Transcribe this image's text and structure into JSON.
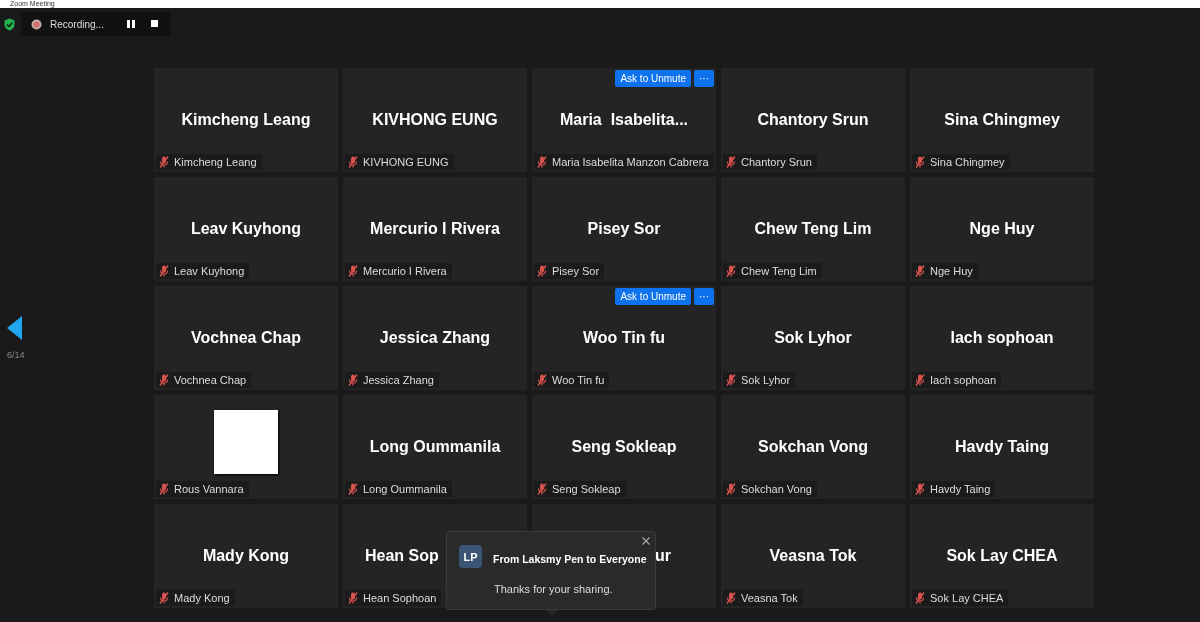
{
  "window": {
    "title": "Zoom Meeting"
  },
  "recording": {
    "label": "Recording..."
  },
  "pager": {
    "label": "6/14"
  },
  "tiles": [
    {
      "kind": "name",
      "display_name": "Kimcheng Leang",
      "label": "Kimcheng Leang",
      "muted": true
    },
    {
      "kind": "name",
      "display_name": "KIVHONG EUNG",
      "label": "KIVHONG EUNG",
      "muted": true
    },
    {
      "kind": "name",
      "display_name": "Maria  Isabelita...",
      "label": "Maria Isabelita Manzon Cabrera",
      "muted": true,
      "actions": {
        "button": "Ask to Unmute",
        "more": "···"
      }
    },
    {
      "kind": "name",
      "display_name": "Chantory Srun",
      "label": "Chantory Srun",
      "muted": true
    },
    {
      "kind": "name",
      "display_name": "Sina Chingmey",
      "label": "Sina Chingmey",
      "muted": true
    },
    {
      "kind": "name",
      "display_name": "Leav Kuyhong",
      "label": "Leav Kuyhong",
      "muted": true
    },
    {
      "kind": "name",
      "display_name": "Mercurio I Rivera",
      "label": "Mercurio I Rivera",
      "muted": true
    },
    {
      "kind": "name",
      "display_name": "Pisey Sor",
      "label": "Pisey Sor",
      "muted": true
    },
    {
      "kind": "name",
      "display_name": "Chew Teng Lim",
      "label": "Chew Teng Lim",
      "muted": true
    },
    {
      "kind": "name",
      "display_name": "Nge Huy",
      "label": "Nge Huy",
      "muted": true
    },
    {
      "kind": "name",
      "display_name": "Vochnea Chap",
      "label": "Vochnea Chap",
      "muted": true
    },
    {
      "kind": "name",
      "display_name": "Jessica Zhang",
      "label": "Jessica Zhang",
      "muted": true
    },
    {
      "kind": "name",
      "display_name": "Woo Tin fu",
      "label": "Woo Tin fu",
      "muted": true,
      "actions": {
        "button": "Ask to Unmute",
        "more": "···"
      }
    },
    {
      "kind": "name",
      "display_name": "Sok Lyhor",
      "label": "Sok Lyhor",
      "muted": true
    },
    {
      "kind": "name",
      "display_name": "Iach sophoan",
      "label": "Iach sophoan",
      "muted": true
    },
    {
      "kind": "avatar",
      "label": "Rous Vannara",
      "muted": true
    },
    {
      "kind": "name",
      "display_name": "Long Oummanila",
      "label": "Long Oummanila",
      "muted": true
    },
    {
      "kind": "name",
      "display_name": "Seng Sokleap",
      "label": "Seng Sokleap",
      "muted": true
    },
    {
      "kind": "name",
      "display_name": "Sokchan Vong",
      "label": "Sokchan Vong",
      "muted": true
    },
    {
      "kind": "name",
      "display_name": "Havdy Taing",
      "label": "Havdy Taing",
      "muted": true
    },
    {
      "kind": "name",
      "display_name": "Mady Kong",
      "label": "Mady Kong",
      "muted": true
    },
    {
      "kind": "name",
      "display_name": "Hean Sop",
      "covered": true,
      "label": "Hean Sophoan",
      "muted": true
    },
    {
      "kind": "name",
      "display_name": "ur",
      "covered": true
    },
    {
      "kind": "name",
      "display_name": "Veasna Tok",
      "label": "Veasna Tok",
      "muted": true
    },
    {
      "kind": "name",
      "display_name": "Sok Lay CHEA",
      "label": "Sok Lay CHEA",
      "muted": true
    }
  ],
  "chat": {
    "avatar": "LP",
    "title": "From Laksmy Pen to Everyone",
    "message": "Thanks for your sharing."
  }
}
